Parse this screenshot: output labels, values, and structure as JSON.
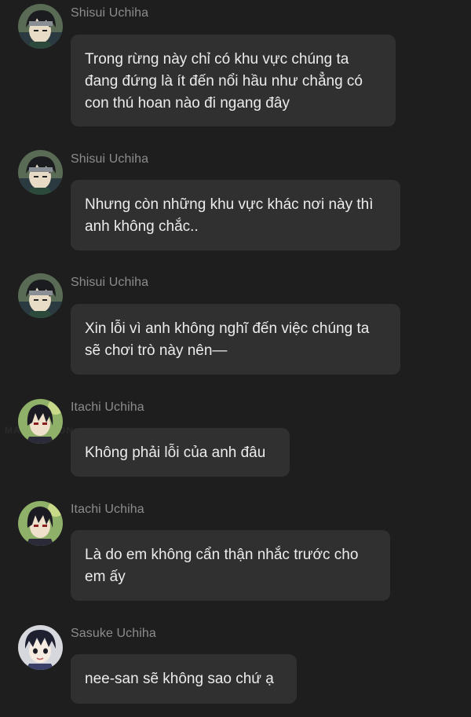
{
  "messages": [
    {
      "sender": "Shisui Uchiha",
      "avatar": "shisui-avatar",
      "lines": [
        "Trong rừng này chỉ có khu vực chúng ta",
        "đang đứng là ít đến nổi hầu như chẳng có",
        "con thú hoan nào đi ngang đây"
      ]
    },
    {
      "sender": "Shisui Uchiha",
      "avatar": "shisui-avatar",
      "lines": [
        "Nhưng còn những khu vực khác nơi này thì",
        "anh không chắc.."
      ]
    },
    {
      "sender": "Shisui Uchiha",
      "avatar": "shisui-avatar",
      "lines": [
        "Xin lỗi vì anh không nghĩ đến việc chúng ta",
        "sẽ chơi trò này nên—"
      ]
    },
    {
      "sender": "Itachi Uchiha",
      "avatar": "itachi-avatar",
      "lines": [
        "Không phải lỗi của anh đâu"
      ]
    },
    {
      "sender": "Itachi Uchiha",
      "avatar": "itachi-avatar",
      "lines": [
        "Là do em không cẩn thận nhắc trước cho",
        "em ấy"
      ]
    },
    {
      "sender": "Sasuke Uchiha",
      "avatar": "sasuke-avatar",
      "lines": [
        "nee-san sẽ không sao chứ ạ"
      ]
    }
  ],
  "watermark": "MANGATOON",
  "colors": {
    "background": "#1e1e1f",
    "bubble": "#303031",
    "sender": "#8c8c8e",
    "text": "#ececec"
  }
}
